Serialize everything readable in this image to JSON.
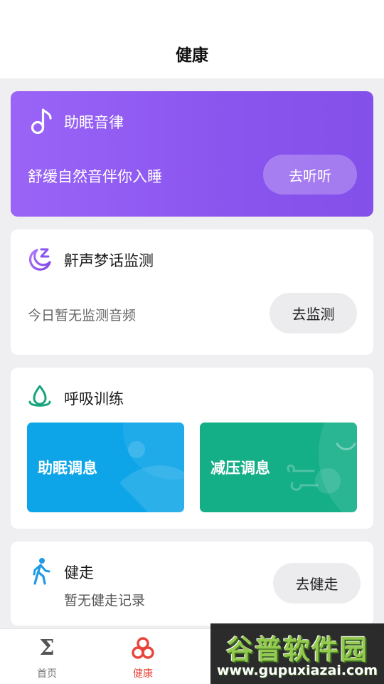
{
  "header": {
    "title": "健康"
  },
  "music_card": {
    "icon": "music-note-icon",
    "title": "助眠音律",
    "subtitle": "舒缓自然音伴你入睡",
    "button_label": "去听听",
    "gradient": [
      "#9a64f7",
      "#844fea"
    ]
  },
  "snore_card": {
    "icon": "moon-zzz-icon",
    "title": "鼾声梦话监测",
    "subtitle": "今日暂无监测音频",
    "button_label": "去监测"
  },
  "breath_card": {
    "icon": "water-drop-icon",
    "title": "呼吸训练",
    "tiles": [
      {
        "label": "助眠调息",
        "color": "#0ea5e8"
      },
      {
        "label": "减压调息",
        "color": "#14ae87"
      }
    ]
  },
  "walk_card": {
    "icon": "walking-person-icon",
    "title": "健走",
    "subtitle": "暂无健走记录",
    "button_label": "去健走"
  },
  "bottom_nav": {
    "items": [
      {
        "label": "首页",
        "icon": "sigma-icon",
        "active": false
      },
      {
        "label": "健康",
        "icon": "health-rings-icon",
        "active": true
      }
    ],
    "active_color": "#e8443a"
  },
  "watermark": {
    "title": "谷普软件园",
    "url": "www.gupuxiazai.com"
  }
}
